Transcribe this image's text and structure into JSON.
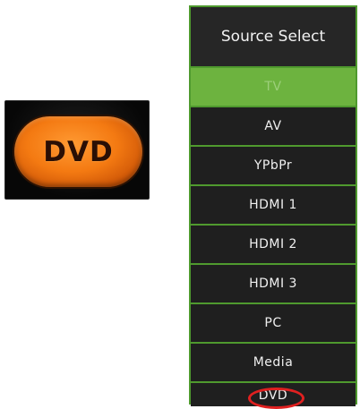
{
  "remote": {
    "button_label": "DVD",
    "key_color": "#f47a12"
  },
  "menu": {
    "title": "Source Select",
    "accent_color": "#4f9a2e",
    "selected_color": "#6db33f",
    "highlight_color": "#e02020",
    "items": [
      {
        "label": "TV",
        "selected": true
      },
      {
        "label": "AV",
        "selected": false
      },
      {
        "label": "YPbPr",
        "selected": false
      },
      {
        "label": "HDMI 1",
        "selected": false
      },
      {
        "label": "HDMI 2",
        "selected": false
      },
      {
        "label": "HDMI 3",
        "selected": false
      },
      {
        "label": "PC",
        "selected": false
      },
      {
        "label": "Media",
        "selected": false
      },
      {
        "label": "DVD",
        "selected": false,
        "circled": true
      }
    ]
  }
}
